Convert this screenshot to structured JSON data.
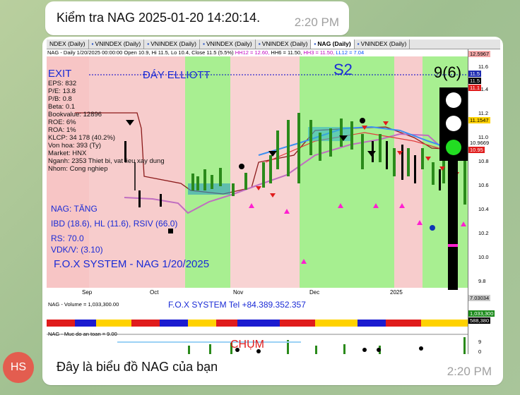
{
  "top_message": {
    "text": "Kiểm tra NAG 2025-01-20 14:20:14.",
    "time": "2:20 PM"
  },
  "reply": {
    "avatar": "HS",
    "text": "Đây là biểu đồ NAG của bạn",
    "time": "2:20 PM"
  },
  "chart": {
    "tabs": [
      "NDEX (Daily)",
      "VNINDEX (Daily)",
      "VNINDEX (Daily)",
      "VNINDEX (Daily)",
      "VNINDEX (Daily)",
      "NAG (Daily)",
      "VNINDEX (Daily)"
    ],
    "header_ohlc": "NAG - Daily 1/20/2025 00:00:00 Open 10.9, Hi 11.5, Lo 10.4, Close 11.5 (5.5%)",
    "header_hh12": "HH12 = 12.60,",
    "header_hh6": "HH6 = 11.50,",
    "header_hh3": "HH3 = 11.50,",
    "header_ll12": "LL12 = 7.04",
    "exit_label": "EXIT",
    "elliott_label": "ĐÁY ELLIOTT",
    "s2_label": "S2",
    "count_label": "9(6)",
    "fundamentals": [
      "EPS: 832",
      "P/E: 13.8",
      "P/B: 0.8",
      "Beta: 0.1",
      "Bookvalue: 12896",
      "ROE: 6%",
      "ROA: 1%",
      "KLCP: 34 178 (40.2%)",
      "Von hoa: 393 (Ty)",
      "Market: HNX",
      "Nganh: 2353 Thiet bi, vat lieu xay dung",
      "Nhom: Cong nghiep"
    ],
    "status": "NAG: TĂNG",
    "indicators": "IBD (18.6), HL (11.6), RSIV (66.0)",
    "rs": "RS: 70.0",
    "vdkv": "VDK/V:  (3.10)",
    "watermark": "F.O.X SYSTEM - NAG 1/20/2025",
    "volume_header": "NAG - Volume = 1,033,300.00",
    "tel_label": "F.O.X SYSTEM Tel +84.389.352.357",
    "safety_header": "NAG - Muc do an toan = 9.00",
    "chum_label": "CHỤM",
    "months": [
      "Sep",
      "Oct",
      "Nov",
      "Dec",
      "2025"
    ],
    "price_ticks": [
      "11.6",
      "11.4",
      "11.2",
      "11.0",
      "10.8",
      "10.6",
      "10.4",
      "10.2",
      "10.0",
      "9.8"
    ],
    "price_tags": [
      "12.5967",
      "11.5",
      "11.5",
      "11.1",
      "11.1547",
      "10.9669",
      "10.95",
      "7.03034"
    ],
    "volume_tags": [
      "1,033,300",
      "588,380"
    ],
    "safety_ticks": [
      "9",
      "0"
    ]
  }
}
